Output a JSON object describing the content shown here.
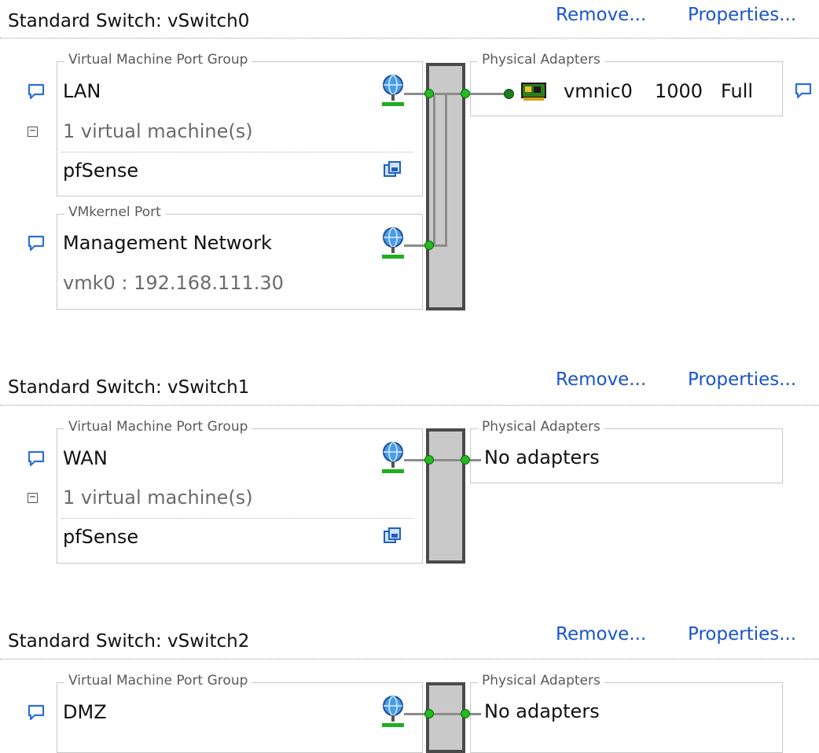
{
  "switches": [
    {
      "title": "Standard Switch: vSwitch0",
      "remove_label": "Remove...",
      "properties_label": "Properties...",
      "port_groups": [
        {
          "legend": "Virtual Machine Port Group",
          "name": "LAN",
          "vm_count": "1 virtual machine(s)",
          "vms": [
            "pfSense"
          ]
        },
        {
          "legend": "VMkernel Port",
          "name": "Management Network",
          "address": "vmk0 : 192.168.111.30"
        }
      ],
      "adapters": {
        "legend": "Physical Adapters",
        "items": [
          {
            "name": "vmnic0",
            "speed": "1000",
            "duplex": "Full"
          }
        ]
      }
    },
    {
      "title": "Standard Switch: vSwitch1",
      "remove_label": "Remove...",
      "properties_label": "Properties...",
      "port_groups": [
        {
          "legend": "Virtual Machine Port Group",
          "name": "WAN",
          "vm_count": "1 virtual machine(s)",
          "vms": [
            "pfSense"
          ]
        }
      ],
      "adapters": {
        "legend": "Physical Adapters",
        "empty_label": "No adapters"
      }
    },
    {
      "title": "Standard Switch: vSwitch2",
      "remove_label": "Remove...",
      "properties_label": "Properties...",
      "port_groups": [
        {
          "legend": "Virtual Machine Port Group",
          "name": "DMZ"
        }
      ],
      "adapters": {
        "legend": "Physical Adapters",
        "empty_label": "No adapters"
      }
    }
  ],
  "icons": {
    "comment": "speech-bubble-icon",
    "network": "network-globe-icon",
    "vm": "virtual-machine-icon",
    "nic": "nic-card-icon",
    "collapse": "collapse-minus-icon"
  },
  "colors": {
    "link": "#1a55c9",
    "port_dot": "#22bb22",
    "bar": "#c9c9c9"
  }
}
